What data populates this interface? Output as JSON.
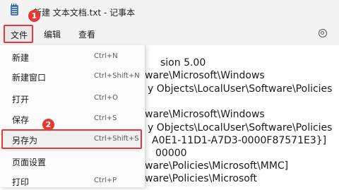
{
  "window": {
    "title": "新建 文本文档.txt - 记事本",
    "app_icon": "notepad-icon"
  },
  "menubar": {
    "file": "文件",
    "edit": "编辑",
    "view": "查看",
    "settings_icon": "gear-icon"
  },
  "annotations": {
    "badge1": "1",
    "badge2": "2",
    "color": "#e53935"
  },
  "file_menu": {
    "items": [
      {
        "label": "新建",
        "shortcut": "Ctrl+N"
      },
      {
        "label": "新建窗口",
        "shortcut": "Ctrl+Shift+N"
      },
      {
        "label": "打开",
        "shortcut": "Ctrl+O"
      },
      {
        "label": "保存",
        "shortcut": "Ctrl+S"
      },
      {
        "label": "另存为",
        "shortcut": "Ctrl+Shift+S"
      },
      {
        "label": "页面设置",
        "shortcut": ""
      },
      {
        "label": "打印",
        "shortcut": "Ctrl+P"
      }
    ]
  },
  "editor": {
    "lines": [
      "sion 5.00",
      "ware\\Microsoft\\Windows",
      "y Objects\\LocalUser\\Software\\Policies",
      "",
      "ware\\Microsoft\\Windows",
      "y Objects\\LocalUser\\Software\\Policies",
      "A0E1-11D1-A7D3-0000F87571E3}]",
      "00000",
      "ware\\Policies\\Microsoft\\MMC]",
      "ware\\Policies\\Microsoft"
    ]
  }
}
